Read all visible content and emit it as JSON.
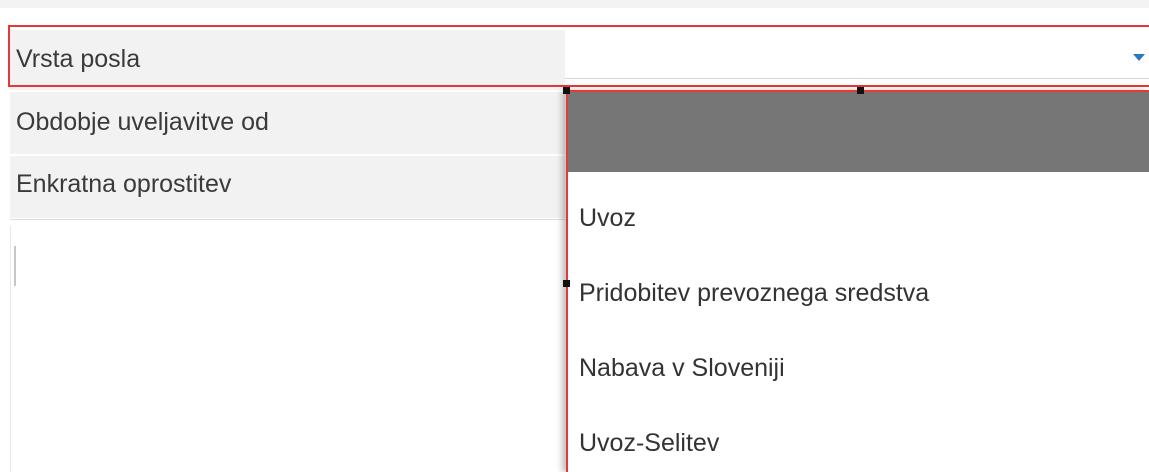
{
  "form": {
    "vrsta_posla_label": "Vrsta posla",
    "vrsta_posla_value": "",
    "obdobje_label": "Obdobje uveljavitve od",
    "enkratna_label": "Enkratna oprostitev"
  },
  "dropdown": {
    "options": [
      "",
      "Uvoz",
      "Pridobitev prevoznega sredstva",
      "Nabava v Sloveniji",
      "Uvoz-Selitev"
    ],
    "highlighted_index": 0
  },
  "colors": {
    "highlight_border": "#e53935",
    "highlighted_option_bg": "#767676",
    "arrow": "#2b78c2",
    "label_bg": "#f2f2f2"
  },
  "icons": {
    "select_arrow": "caret-down-icon"
  }
}
